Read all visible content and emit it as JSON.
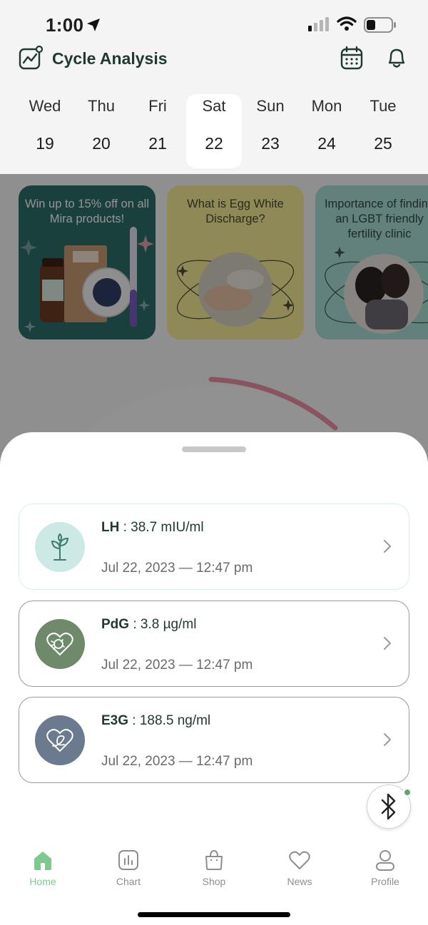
{
  "status_bar": {
    "time": "1:00"
  },
  "header": {
    "title": "Cycle Analysis"
  },
  "week": [
    {
      "name": "Wed",
      "num": "19"
    },
    {
      "name": "Thu",
      "num": "20"
    },
    {
      "name": "Fri",
      "num": "21"
    },
    {
      "name": "Sat",
      "num": "22",
      "selected": true
    },
    {
      "name": "Sun",
      "num": "23"
    },
    {
      "name": "Mon",
      "num": "24"
    },
    {
      "name": "Tue",
      "num": "25"
    }
  ],
  "promos": [
    {
      "title": "Win up to 15% off on all Mira products!"
    },
    {
      "title": "What is Egg White Discharge?"
    },
    {
      "title": "Importance of finding an LGBT friendly fertility clinic"
    }
  ],
  "readings": [
    {
      "hormone": "LH",
      "value": " : 38.7  mIU/ml",
      "date": "Jul 22, 2023  —  12:47 pm",
      "icon": "sprout-icon",
      "color": "#cce9e6"
    },
    {
      "hormone": "PdG",
      "value": " : 3.8  µg/ml",
      "date": "Jul 22, 2023  —  12:47 pm",
      "icon": "heart-egg-icon",
      "color": "#6e8a6a"
    },
    {
      "hormone": "E3G",
      "value": " : 188.5  ng/ml",
      "date": "Jul 22, 2023  —  12:47 pm",
      "icon": "heart-leaf-icon",
      "color": "#6b7a8f"
    }
  ],
  "tabs": [
    {
      "label": "Home",
      "icon": "home-icon",
      "active": true
    },
    {
      "label": "Chart",
      "icon": "chart-icon"
    },
    {
      "label": "Shop",
      "icon": "bag-icon"
    },
    {
      "label": "News",
      "icon": "heart-icon"
    },
    {
      "label": "Profile",
      "icon": "person-icon"
    }
  ],
  "colors": {
    "accent": "#7ec98f",
    "text_dark": "#203a32",
    "bluetooth_dot": "#5aa96a"
  }
}
